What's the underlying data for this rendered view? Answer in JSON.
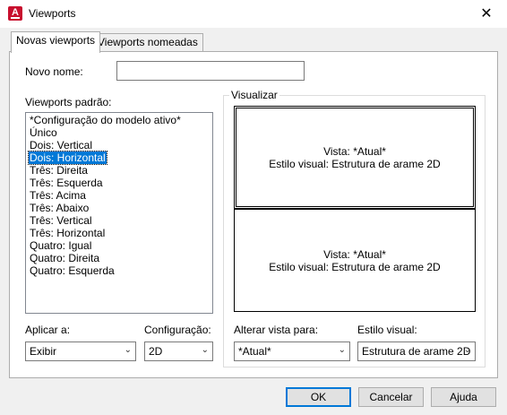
{
  "window": {
    "title": "Viewports",
    "close_glyph": "✕"
  },
  "tabs": [
    {
      "label": "Novas viewports"
    },
    {
      "label": "Viewports nomeadas"
    }
  ],
  "new_name": {
    "label": "Novo nome:",
    "value": ""
  },
  "standard_viewports": {
    "label": "Viewports padrão:",
    "items": [
      "*Configuração do modelo ativo*",
      "Único",
      "Dois: Vertical",
      "Dois: Horizontal",
      "Três: Direita",
      "Três: Esquerda",
      "Três: Acima",
      "Três: Abaixo",
      "Três: Vertical",
      "Três: Horizontal",
      "Quatro:  Igual",
      "Quatro:  Direita",
      "Quatro:  Esquerda"
    ],
    "selected": "Dois: Horizontal"
  },
  "preview": {
    "label": "Visualizar",
    "top_line1": "Vista: *Atual*",
    "top_line2": "Estilo visual: Estrutura de arame 2D",
    "bottom_line1": "Vista: *Atual*",
    "bottom_line2": "Estilo visual: Estrutura de arame 2D"
  },
  "apply_to": {
    "label": "Aplicar a:",
    "value": "Exibir"
  },
  "setup": {
    "label": "Configuração:",
    "value": "2D"
  },
  "change_view": {
    "label": "Alterar vista para:",
    "value": "*Atual*"
  },
  "visual_style": {
    "label": "Estilo visual:",
    "value": "Estrutura de arame 2D"
  },
  "buttons": {
    "ok": "OK",
    "cancel": "Cancelar",
    "help": "Ajuda"
  },
  "colors": {
    "selection": "#0078d7",
    "app_icon": "#c8102e"
  }
}
